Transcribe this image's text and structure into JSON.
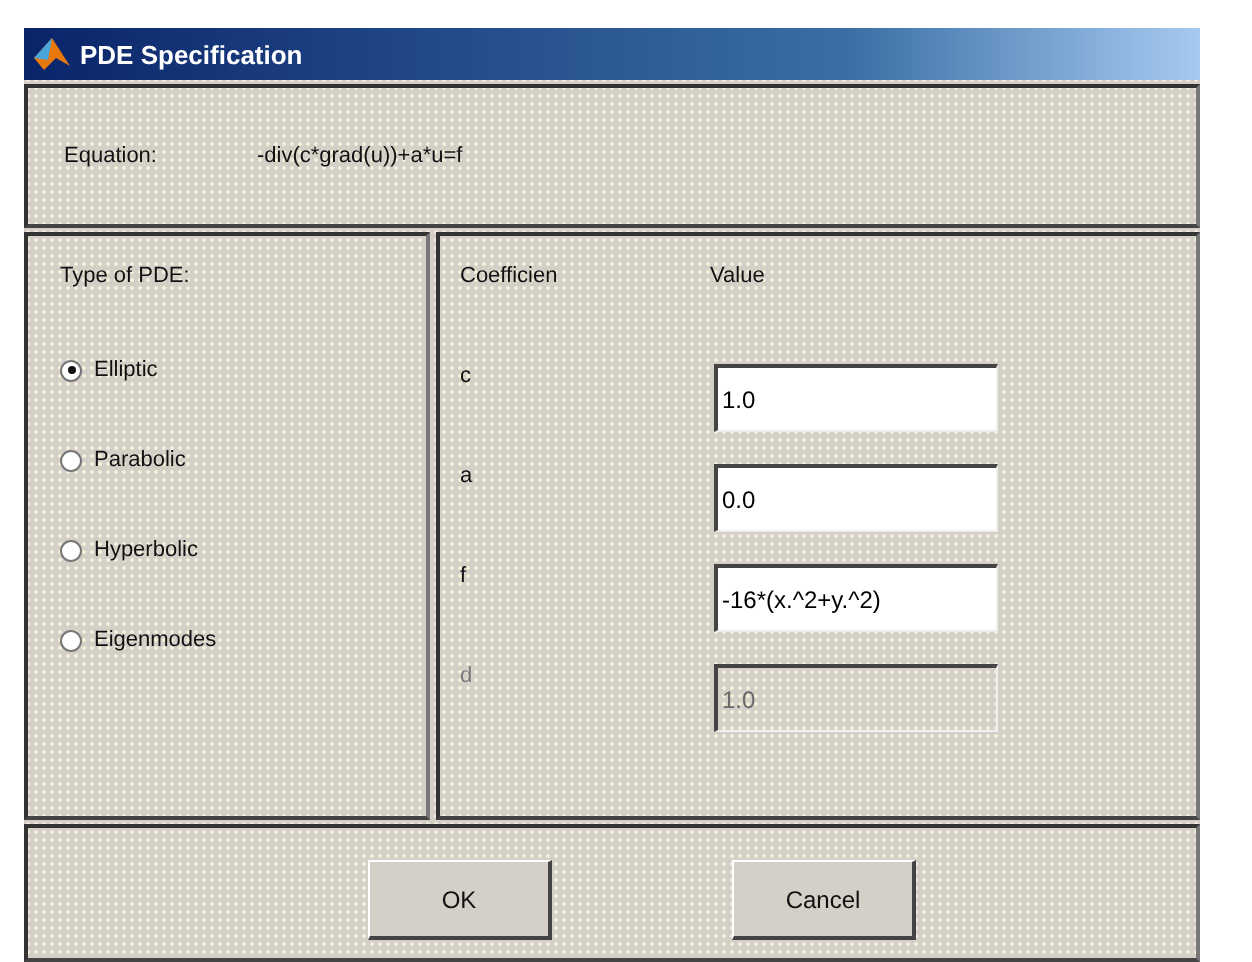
{
  "window": {
    "title": "PDE Specification"
  },
  "equation": {
    "label": "Equation:",
    "value": "-div(c*grad(u))+a*u=f"
  },
  "pde_type": {
    "label": "Type of PDE:",
    "options": [
      {
        "label": "Elliptic",
        "selected": true
      },
      {
        "label": "Parabolic",
        "selected": false
      },
      {
        "label": "Hyperbolic",
        "selected": false
      },
      {
        "label": "Eigenmodes",
        "selected": false
      }
    ]
  },
  "coefficients": {
    "columns": [
      "Coefficien",
      "Value"
    ],
    "rows": [
      {
        "name": "c",
        "value": "1.0",
        "disabled": false
      },
      {
        "name": "a",
        "value": "0.0",
        "disabled": false
      },
      {
        "name": "f",
        "value": "-16*(x.^2+y.^2)",
        "disabled": false
      },
      {
        "name": "d",
        "value": "1.0",
        "disabled": true
      }
    ]
  },
  "buttons": [
    "OK",
    "Cancel"
  ]
}
